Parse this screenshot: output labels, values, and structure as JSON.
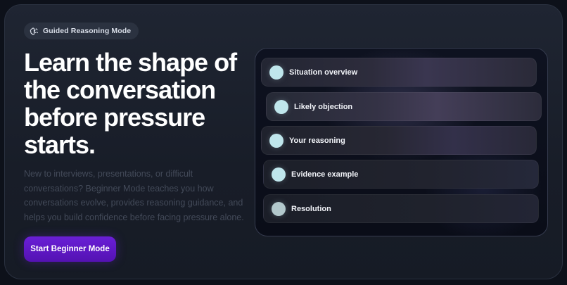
{
  "badge": {
    "label": "Guided Reasoning Mode",
    "icon": "brain-icon"
  },
  "hero": {
    "headline": "Learn the shape of the conversation before pressure starts.",
    "description": "New to interviews, presentations, or difficult conversations? Beginner Mode teaches you how conversations evolve, provides reasoning guidance, and helps you build confidence before facing pressure alone.",
    "cta_label": "Start Beginner Mode"
  },
  "steps": [
    {
      "label": "Situation overview"
    },
    {
      "label": "Likely objection"
    },
    {
      "label": "Your reasoning"
    },
    {
      "label": "Evidence example"
    },
    {
      "label": "Resolution"
    }
  ],
  "colors": {
    "accent": "#5e17c4",
    "step_dot": "#bfe6ec",
    "headline": "#ffffff",
    "description": "#434a59"
  }
}
